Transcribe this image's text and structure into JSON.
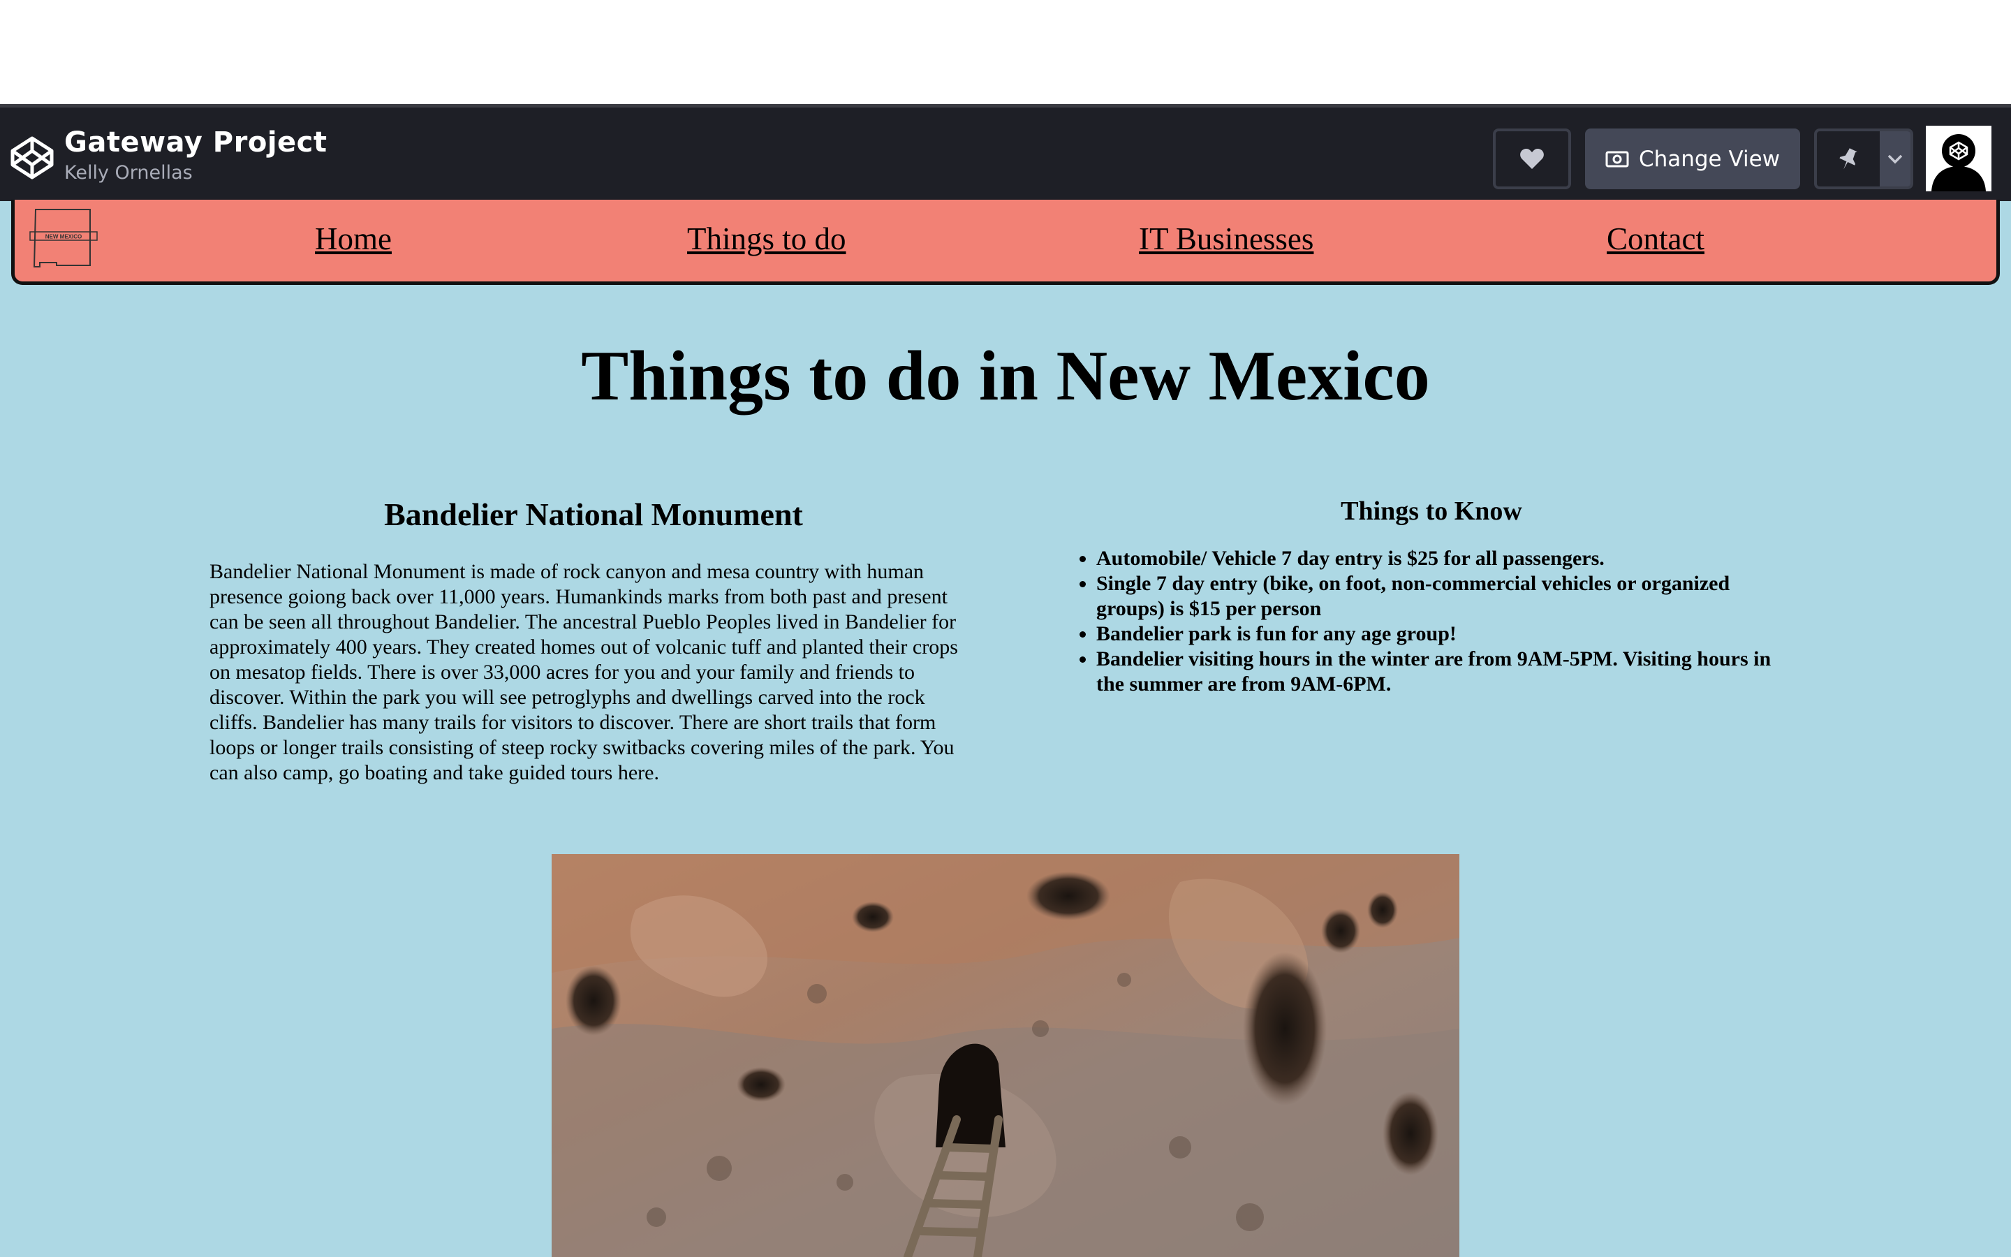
{
  "codepen_header": {
    "project_title": "Gateway Project",
    "author": "Kelly Ornellas",
    "change_view_label": "Change View"
  },
  "nav": {
    "logo_text": "NEW MEXICO",
    "links": [
      "Home",
      "Things to do",
      "IT Businesses",
      "Contact"
    ]
  },
  "page": {
    "title": "Things to do in New Mexico"
  },
  "bandelier": {
    "heading": "Bandelier National Monument",
    "body": "Bandelier National Monument is made of rock canyon and mesa country with human presence goiong back over 11,000 years. Humankinds marks from both past and present can be seen all throughout Bandelier. The ancestral Pueblo Peoples lived in Bandelier for approximately 400 years. They created homes out of volcanic tuff and planted their crops on mesatop fields. There is over 33,000 acres for you and your family and friends to discover. Within the park you will see petroglyphs and dwellings carved into the rock cliffs. Bandelier has many trails for visitors to discover. There are short trails that form loops or longer trails consisting of steep rocky switbacks covering miles of the park. You can also camp, go boating and take guided tours here."
  },
  "things_to_know": {
    "heading": "Things to Know",
    "items": [
      "Automobile/ Vehicle 7 day entry is $25 for all passengers.",
      "Single 7 day entry (bike, on foot, non-commercial vehicles or organized groups) is $15 per person",
      "Bandelier park is fun for any age group!",
      "Bandelier visiting hours in the winter are from 9AM-5PM. Visiting hours in the summer are from 9AM-6PM."
    ]
  },
  "colors": {
    "page_bg": "#add8e4",
    "nav_bg": "#f28175",
    "header_bg": "#1e1f26"
  },
  "icons": [
    "codepen-logo-icon",
    "heart-icon",
    "eye-icon",
    "pin-icon",
    "chevron-down-icon",
    "new-mexico-state-icon"
  ]
}
